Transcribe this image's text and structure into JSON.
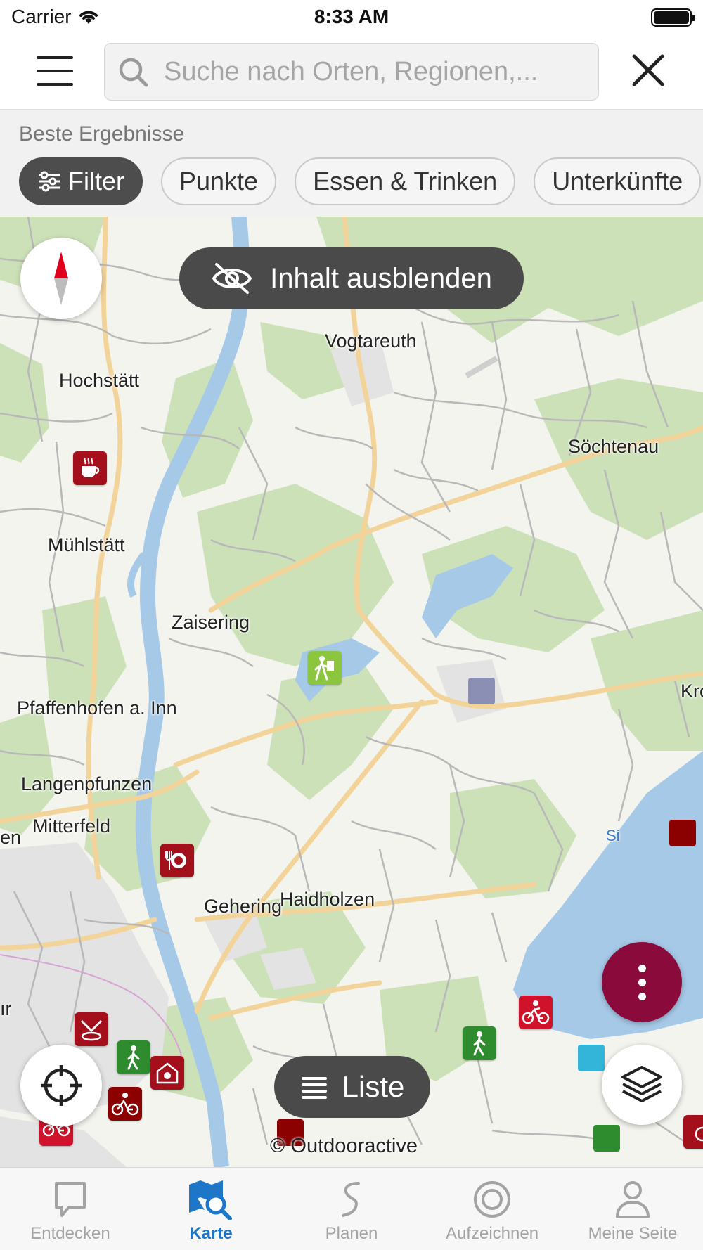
{
  "status_bar": {
    "carrier": "Carrier",
    "time": "8:33 AM"
  },
  "search": {
    "placeholder": "Suche nach Orten, Regionen,...",
    "value": ""
  },
  "filter_section": {
    "title": "Beste Ergebnisse",
    "chips": [
      "Filter",
      "Punkte",
      "Essen & Trinken",
      "Unterkünfte"
    ]
  },
  "map": {
    "hide_content_label": "Inhalt ausblenden",
    "list_label": "Liste",
    "copyright": "© Outdooractive",
    "places": [
      "Vogtareuth",
      "Hochstätt",
      "Söchtenau",
      "Mühlstätt",
      "Zaisering",
      "Pfaffenhofen a. Inn",
      "Langenpfunzen",
      "Mitterfeld",
      "Gehering",
      "Haidholzen",
      "Kro",
      "en",
      "ır",
      "Si"
    ]
  },
  "tabbar": {
    "tabs": [
      {
        "label": "Entdecken",
        "icon": "speech-bubble-icon"
      },
      {
        "label": "Karte",
        "icon": "map-search-icon"
      },
      {
        "label": "Planen",
        "icon": "route-plan-icon"
      },
      {
        "label": "Aufzeichnen",
        "icon": "record-icon"
      },
      {
        "label": "Meine Seite",
        "icon": "person-icon"
      }
    ],
    "active": "Karte"
  },
  "colors": {
    "accent_blue": "#1d76c7",
    "fab_bg": "#8a0a3c",
    "poi_red": "#a3101c",
    "poi_green": "#2e8b2e"
  }
}
